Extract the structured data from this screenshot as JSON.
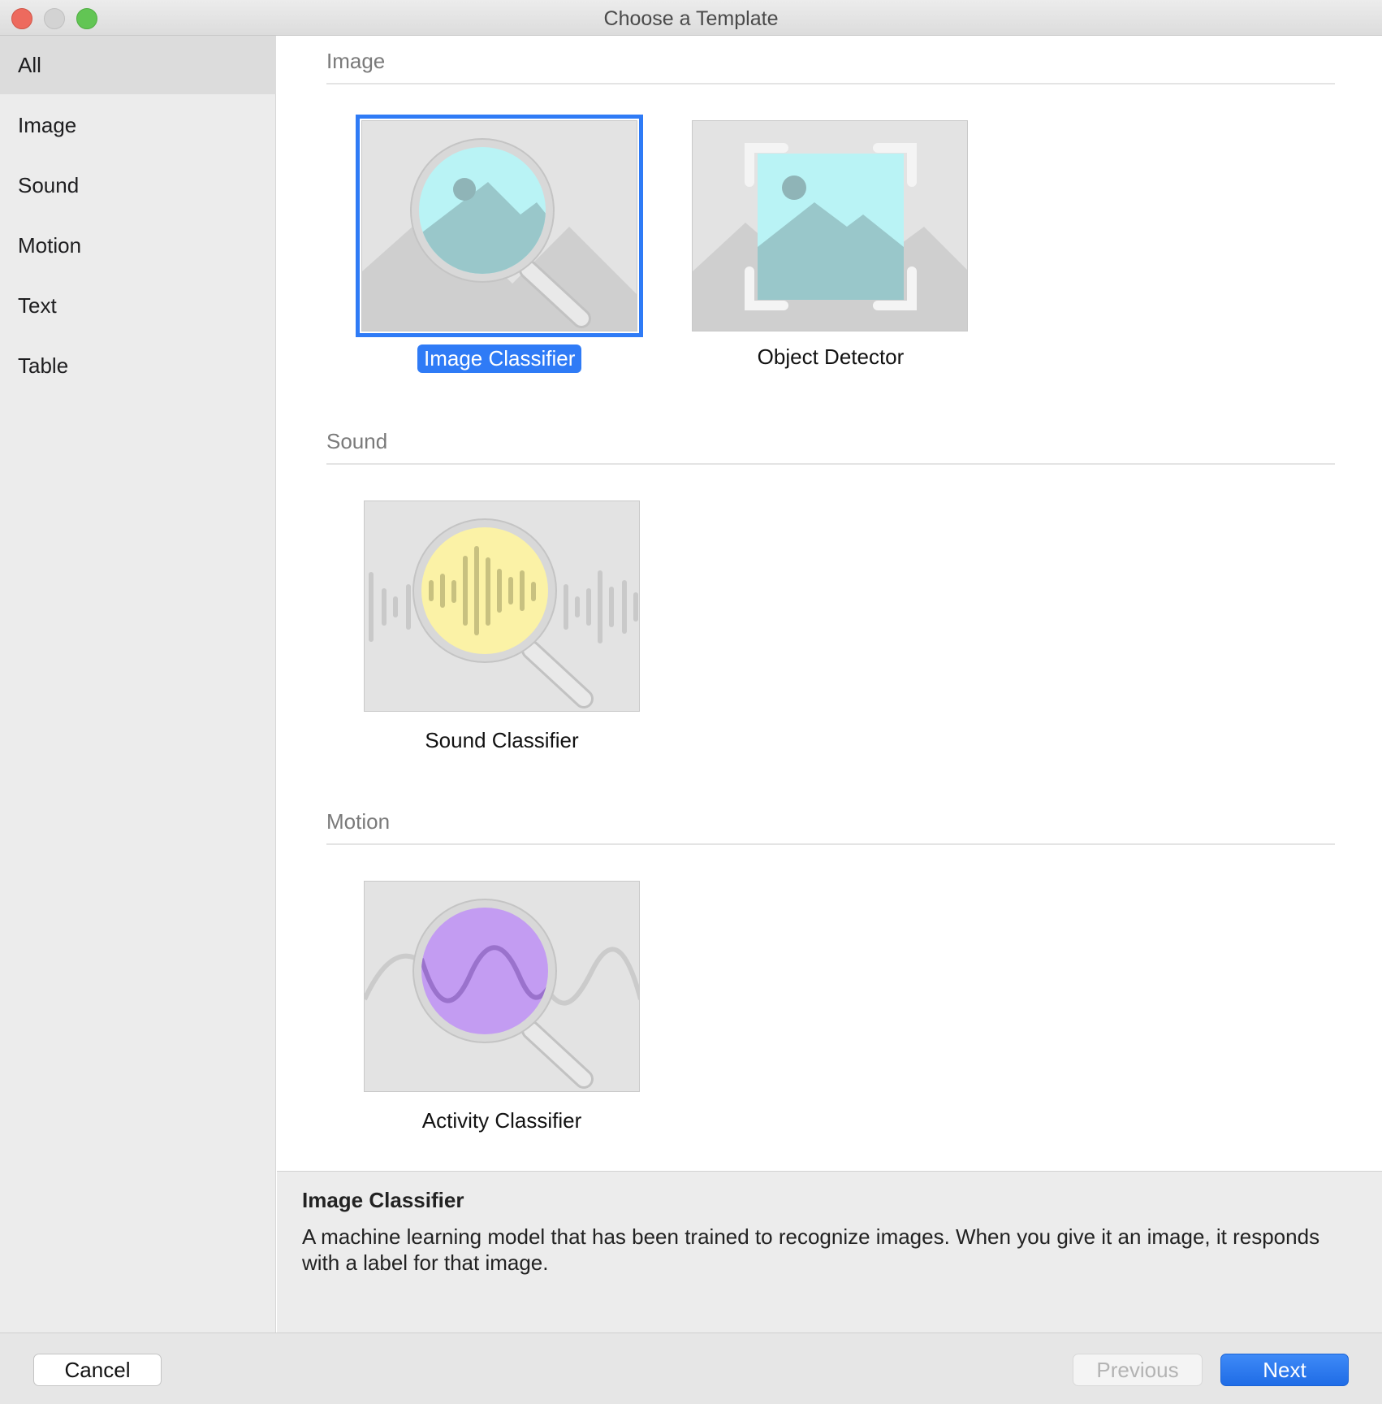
{
  "window": {
    "title": "Choose a Template"
  },
  "sidebar": {
    "items": [
      {
        "label": "All",
        "selected": true
      },
      {
        "label": "Image"
      },
      {
        "label": "Sound"
      },
      {
        "label": "Motion"
      },
      {
        "label": "Text"
      },
      {
        "label": "Table"
      }
    ]
  },
  "sections": [
    {
      "title": "Image",
      "templates": [
        {
          "label": "Image Classifier",
          "selected": true
        },
        {
          "label": "Object Detector"
        }
      ]
    },
    {
      "title": "Sound",
      "templates": [
        {
          "label": "Sound Classifier"
        }
      ]
    },
    {
      "title": "Motion",
      "templates": [
        {
          "label": "Activity Classifier"
        }
      ]
    }
  ],
  "description": {
    "title": "Image Classifier",
    "body": "A machine learning model that has been trained to recognize images. When you give it an image, it responds with a label for that image."
  },
  "footer": {
    "cancel_label": "Cancel",
    "previous_label": "Previous",
    "next_label": "Next"
  },
  "colors": {
    "accent": "#2f7bf6",
    "image_lens": "#b9f3f5",
    "sound_lens": "#fbf2a6",
    "motion_lens": "#c39cf2"
  }
}
